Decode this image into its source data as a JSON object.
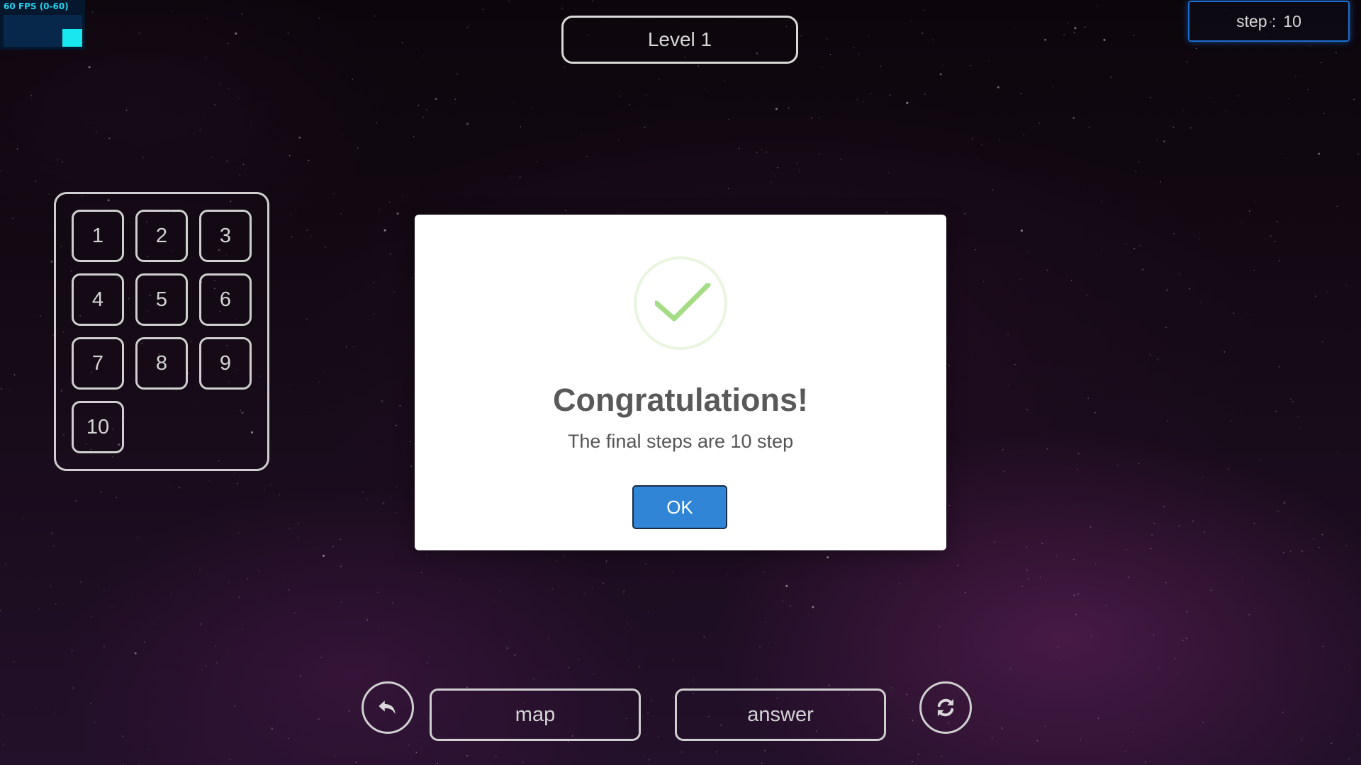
{
  "fps": {
    "label": "60 FPS (0-60)",
    "current_fraction": 0.55
  },
  "header": {
    "level_title": "Level 1",
    "step_label": "step :",
    "step_value": "10"
  },
  "level_select": {
    "levels": [
      "1",
      "2",
      "3",
      "4",
      "5",
      "6",
      "7",
      "8",
      "9",
      "10"
    ]
  },
  "controls": {
    "undo_icon": "undo-arrow-icon",
    "map_label": "map",
    "answer_label": "answer",
    "restart_icon": "refresh-icon"
  },
  "dialog": {
    "icon": "success-checkmark-icon",
    "title": "Congratulations!",
    "message": "The final steps are 10 step",
    "ok_label": "OK"
  },
  "colors": {
    "accent_blue": "#3085d6",
    "success_green": "#a5dc86",
    "fps_cyan": "#19e7ef",
    "step_border": "#1a6fd0"
  }
}
